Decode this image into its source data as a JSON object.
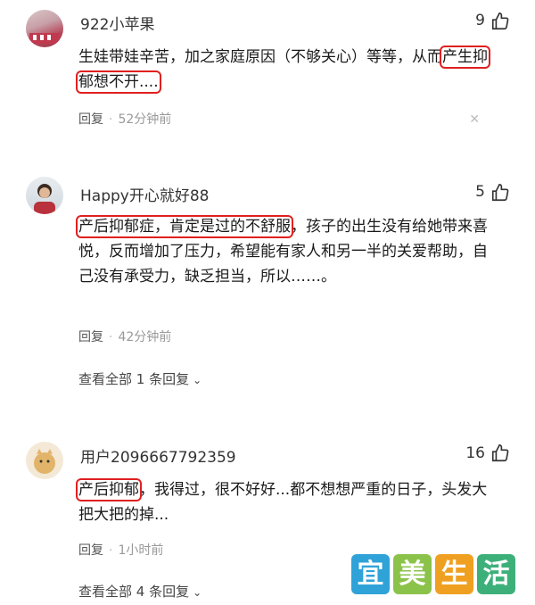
{
  "comments": [
    {
      "username": "922小苹果",
      "likes": "9",
      "text_before": "生娃带娃辛苦，加之家庭原因（不够关心）等等，从而",
      "highlight": "产生抑郁想不开....",
      "text_after": "",
      "reply_label": "回复",
      "time": "52分钟前"
    },
    {
      "username": "Happy开心就好88",
      "likes": "5",
      "text_before": "",
      "highlight": "产后抑郁症，肯定是过的不舒服",
      "text_after": "，孩子的出生没有给她带来喜悦，反而增加了压力，希望能有家人和另一半的关爱帮助，自己没有承受力，缺乏担当，所以……。",
      "reply_label": "回复",
      "time": "42分钟前",
      "view_all": "查看全部 1 条回复"
    },
    {
      "username": "用户2096667792359",
      "likes": "16",
      "text_before": "",
      "highlight": "产后抑郁",
      "text_after": "，我得过，很不好好...都不想想严重的日子，头发大把大把的掉...",
      "reply_label": "回复",
      "time": "1小时前",
      "view_all": "查看全部 4 条回复"
    }
  ],
  "watermark": [
    "宜",
    "美",
    "生",
    "活"
  ],
  "colors": {
    "highlight": "#e02020",
    "wm1": "#2fa3d8",
    "wm2": "#8bc34a",
    "wm3": "#f0a020",
    "wm4": "#3db07a"
  }
}
